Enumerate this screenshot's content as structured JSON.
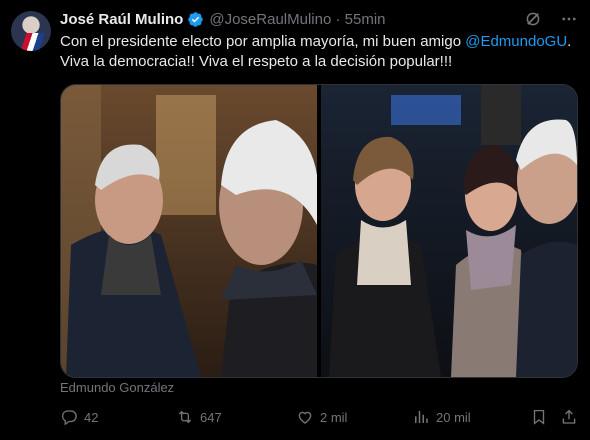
{
  "post": {
    "author_name": "José Raúl Mulino",
    "handle": "@JoseRaulMulino",
    "separator": " · ",
    "time": "55min",
    "text_part1": "Con el presidente electo por amplia mayoría, mi buen amigo ",
    "mention": "@EdmundoGU",
    "text_part2": ". Viva la democracia!! Viva el respeto a la decisión popular!!!",
    "media_caption": "Edmundo González",
    "stats": {
      "replies": "42",
      "reposts": "647",
      "likes": "2 mil",
      "views": "20 mil"
    }
  },
  "icons": [
    "verified-badge-icon",
    "grok-icon",
    "more-icon",
    "reply-icon",
    "repost-icon",
    "like-icon",
    "views-icon",
    "bookmark-icon",
    "share-icon"
  ],
  "colors": {
    "background": "#000000",
    "text": "#e7e9ea",
    "secondary": "#71767b",
    "accent": "#1d9bf0"
  }
}
